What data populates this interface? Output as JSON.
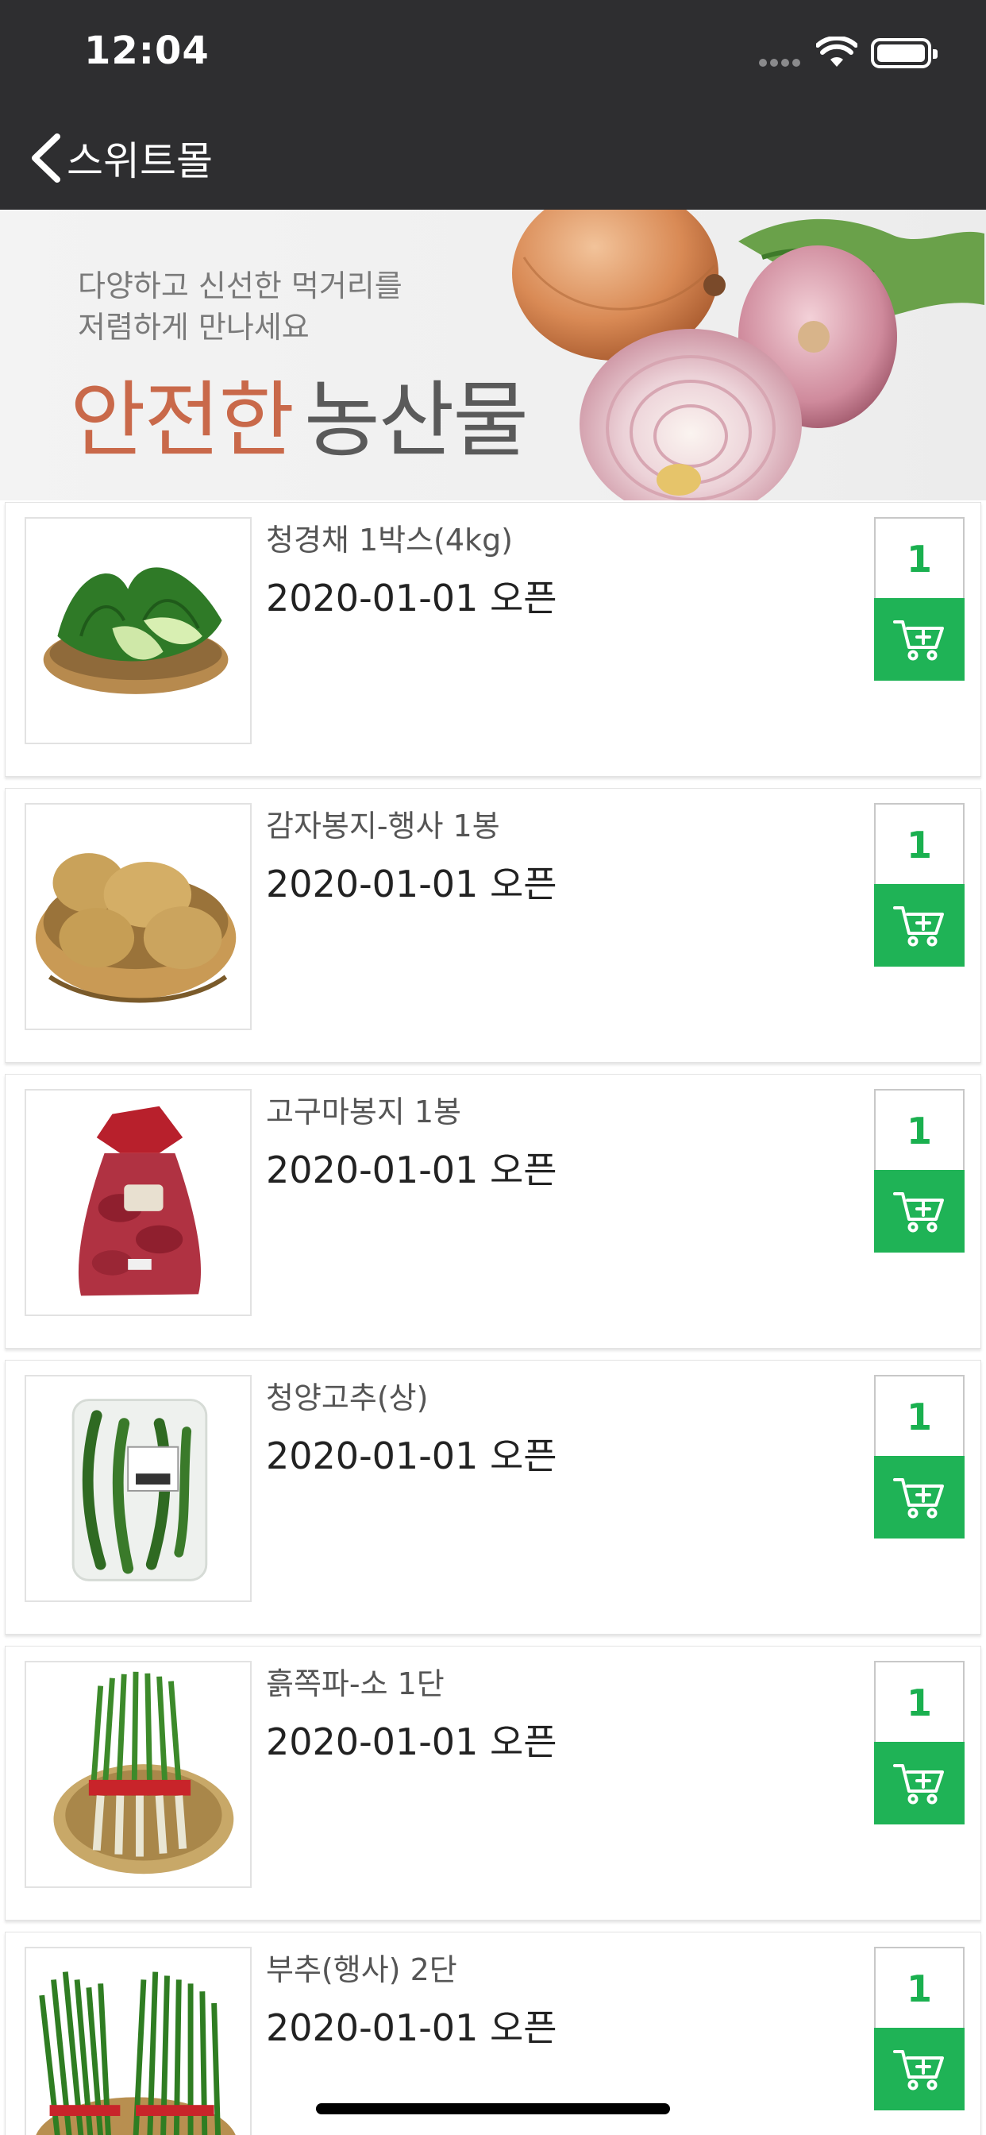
{
  "status_bar": {
    "time": "12:04",
    "icons": [
      "signal-icon",
      "wifi-icon",
      "battery-icon"
    ]
  },
  "nav": {
    "back_icon": "chevron-left-icon",
    "title": "스위트몰"
  },
  "banner": {
    "subtitle_line1": "다양하고 신선한 먹거리를",
    "subtitle_line2": "저렴하게 만나세요",
    "title_accent": "안전한",
    "title_main": "농산물"
  },
  "colors": {
    "nav_bg": "#2e2e30",
    "accent_green": "#1fb356",
    "banner_accent": "#c9694a"
  },
  "products": [
    {
      "name": "청경채 1박스(4kg)",
      "date": "2020-01-01 오픈",
      "qty": "1",
      "image": "bok-choy-in-basket"
    },
    {
      "name": "감자봉지-행사 1봉",
      "date": "2020-01-01 오픈",
      "qty": "1",
      "image": "potatoes-in-basket"
    },
    {
      "name": "고구마봉지 1봉",
      "date": "2020-01-01 오픈",
      "qty": "1",
      "image": "sweet-potato-bag"
    },
    {
      "name": "청양고추(상)",
      "date": "2020-01-01 오픈",
      "qty": "1",
      "image": "green-chili-pack"
    },
    {
      "name": "흙쪽파-소 1단",
      "date": "2020-01-01 오픈",
      "qty": "1",
      "image": "green-onion-bundle"
    },
    {
      "name": "부추(행사) 2단",
      "date": "2020-01-01 오픈",
      "qty": "1",
      "image": "chives-bundle"
    }
  ],
  "cart_icon": "add-to-cart-icon"
}
